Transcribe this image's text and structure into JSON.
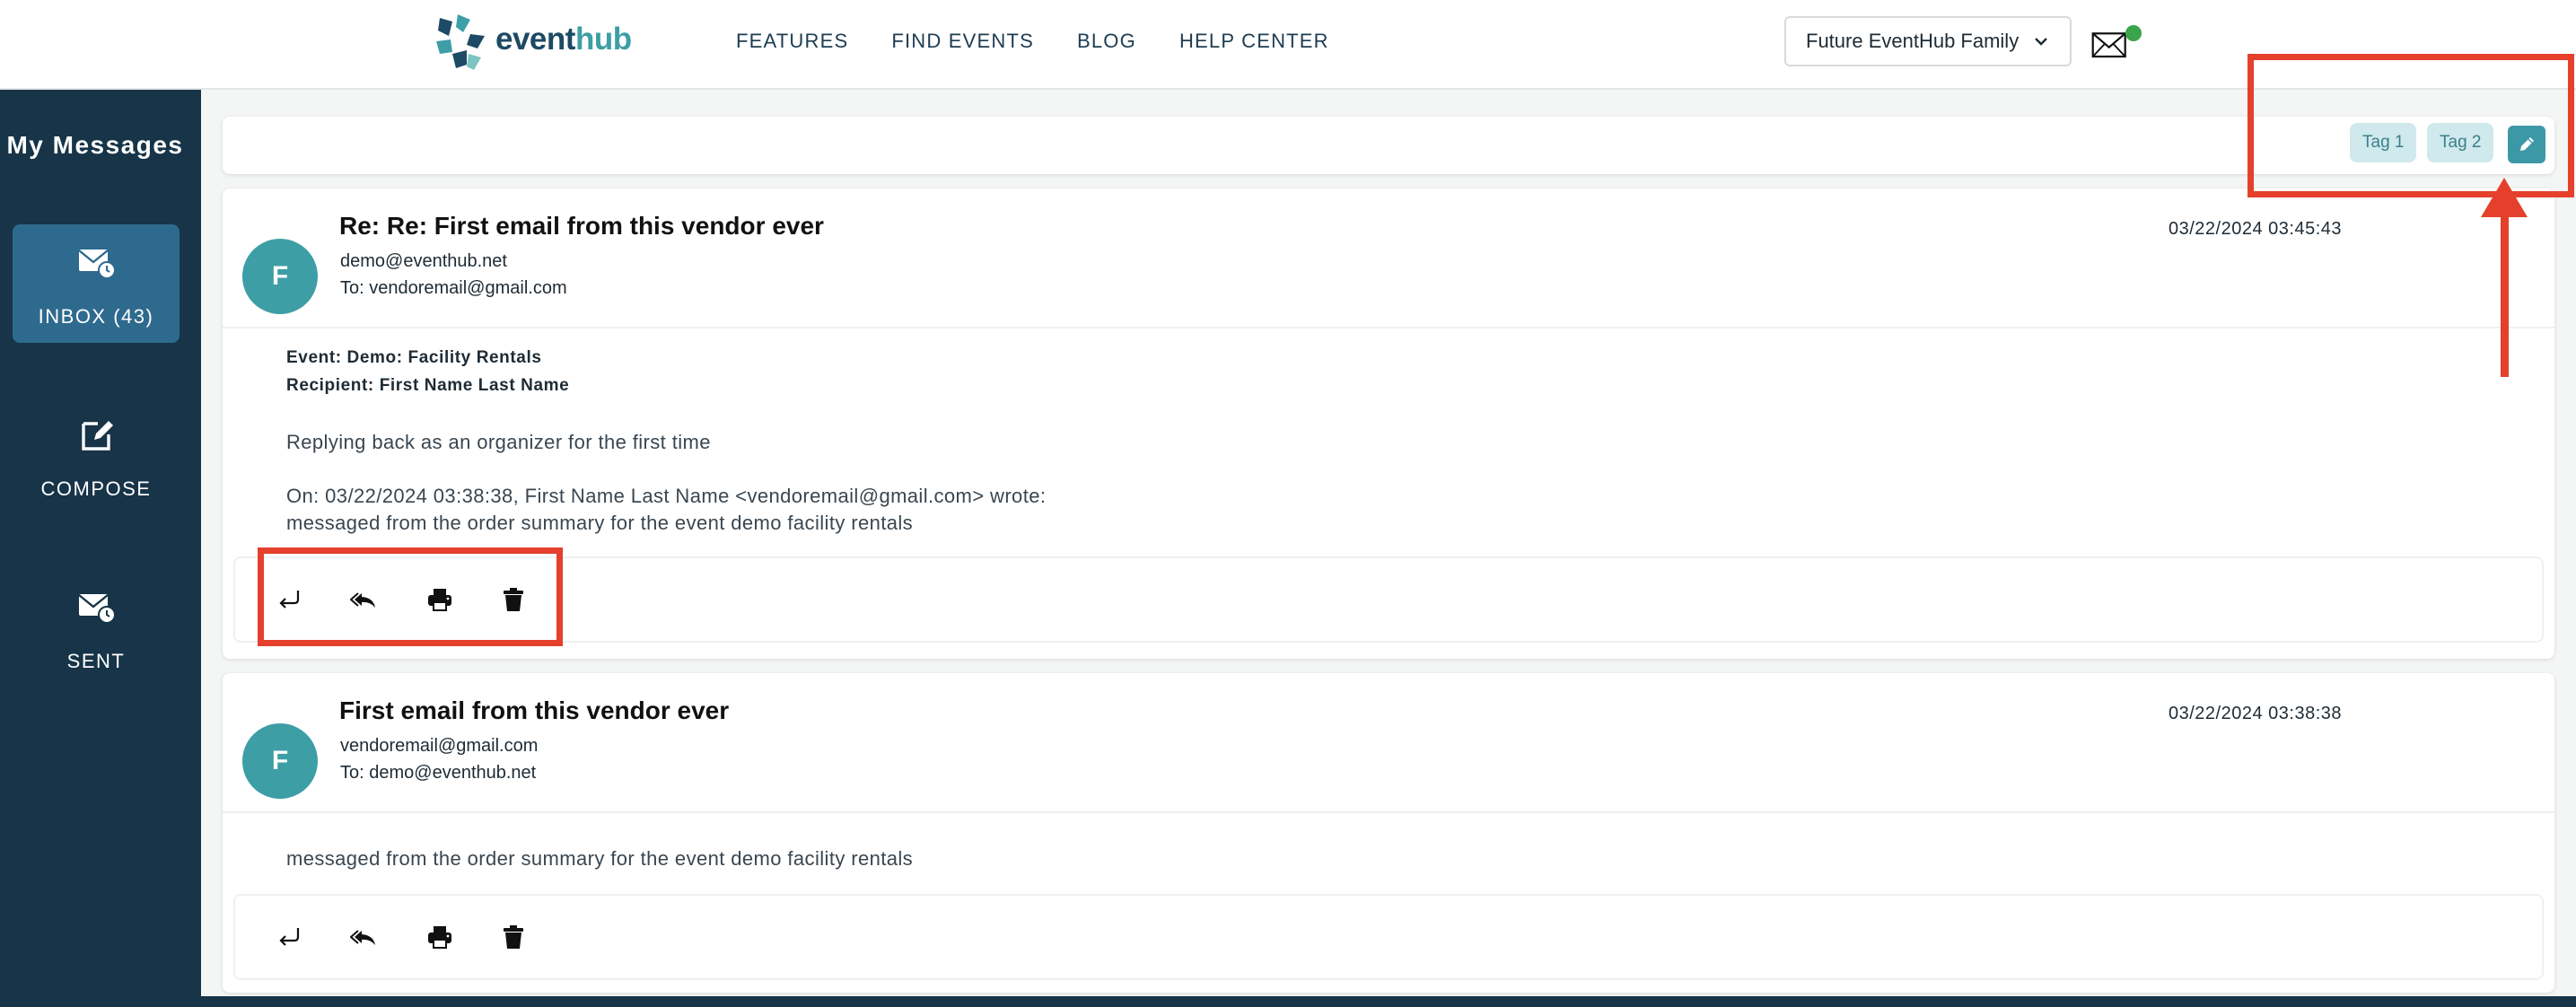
{
  "header": {
    "logo_word_1": "event",
    "logo_word_2": "hub",
    "nav": [
      "FEATURES",
      "FIND EVENTS",
      "BLOG",
      "HELP CENTER"
    ],
    "account_select": "Future EventHub Family",
    "notification_color": "#3aa54a"
  },
  "sidebar": {
    "title": "My Messages",
    "items": [
      {
        "label": "INBOX (43)",
        "icon": "inbox-icon",
        "active": true
      },
      {
        "label": "COMPOSE",
        "icon": "compose-icon",
        "active": false
      },
      {
        "label": "SENT",
        "icon": "sent-icon",
        "active": false
      }
    ]
  },
  "tags": [
    "Tag 1",
    "Tag 2"
  ],
  "messages": [
    {
      "avatar": "F",
      "subject": "Re: Re: First email from this vendor ever",
      "from": "demo@eventhub.net",
      "to": "To: vendoremail@gmail.com",
      "date": "03/22/2024 03:45:43",
      "event": "Event: Demo: Facility Rentals",
      "recipient": "Recipient: First Name Last Name",
      "body": [
        "Replying back as an organizer for the first time",
        "On: 03/22/2024 03:38:38, First Name Last Name <vendoremail@gmail.com> wrote:",
        "messaged from the order summary for the event demo facility rentals"
      ]
    },
    {
      "avatar": "F",
      "subject": "First email from this vendor ever",
      "from": "vendoremail@gmail.com",
      "to": "To: demo@eventhub.net",
      "date": "03/22/2024 03:38:38",
      "body": [
        "messaged from the order summary for the event demo facility rentals"
      ]
    }
  ],
  "actions": [
    "reply-icon",
    "reply-all-icon",
    "print-icon",
    "trash-icon"
  ],
  "colors": {
    "sidebar": "#173448",
    "sidebar_active": "#2e6a8e",
    "accent": "#3d9ea6",
    "annotation": "#e4402c"
  }
}
